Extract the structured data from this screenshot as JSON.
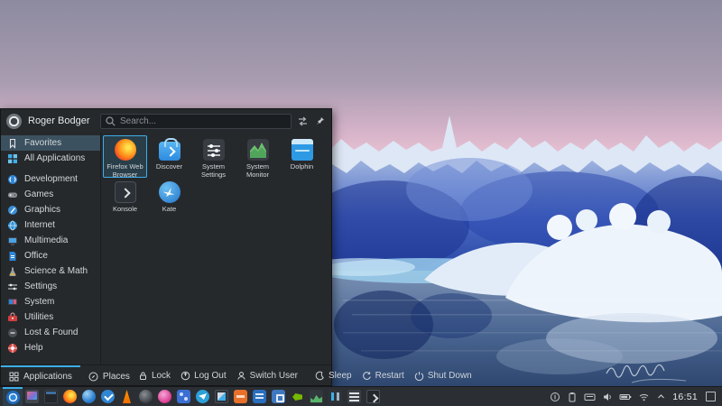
{
  "colors": {
    "accent": "#3daee9",
    "panel_bg": "#2b2f34",
    "menu_bg": "#26292c",
    "selection_bg": "#3c5160"
  },
  "launcher": {
    "user": {
      "name": "Roger Bodger",
      "avatar_icon": "kubuntu-user-logo"
    },
    "search": {
      "placeholder": "Search...",
      "leading_icon": "search-icon",
      "trailing_icons": [
        "sort-icon",
        "pin-icon"
      ]
    },
    "sidebar": {
      "selected": "Favorites",
      "items": [
        {
          "label": "Favorites",
          "icon": "bookmark-icon"
        },
        {
          "label": "All Applications",
          "icon": "apps-grid-icon"
        },
        {
          "label": "Development",
          "icon": "development-icon"
        },
        {
          "label": "Games",
          "icon": "games-icon"
        },
        {
          "label": "Graphics",
          "icon": "graphics-icon"
        },
        {
          "label": "Internet",
          "icon": "internet-globe-icon"
        },
        {
          "label": "Multimedia",
          "icon": "multimedia-icon"
        },
        {
          "label": "Office",
          "icon": "office-icon"
        },
        {
          "label": "Science & Math",
          "icon": "science-math-icon"
        },
        {
          "label": "Settings",
          "icon": "settings-sliders-icon"
        },
        {
          "label": "System",
          "icon": "system-monitor-icon"
        },
        {
          "label": "Utilities",
          "icon": "utilities-toolbox-icon"
        },
        {
          "label": "Lost & Found",
          "icon": "lost-found-icon"
        },
        {
          "label": "Help",
          "icon": "help-lifebuoy-icon"
        }
      ]
    },
    "apps": [
      {
        "label": "Firefox Web Browser",
        "icon": "firefox-icon",
        "selected": true
      },
      {
        "label": "Discover",
        "icon": "discover-icon",
        "selected": false
      },
      {
        "label": "System Settings",
        "icon": "system-settings-icon",
        "selected": false
      },
      {
        "label": "System Monitor",
        "icon": "system-monitor-icon",
        "selected": false
      },
      {
        "label": "Dolphin",
        "icon": "dolphin-icon",
        "selected": false
      },
      {
        "label": "Konsole",
        "icon": "konsole-icon",
        "selected": false
      },
      {
        "label": "Kate",
        "icon": "kate-icon",
        "selected": false
      }
    ],
    "footer": {
      "tabs": [
        {
          "label": "Applications",
          "icon": "grid-tab-icon",
          "active": true
        },
        {
          "label": "Places",
          "icon": "compass-icon",
          "active": false
        }
      ],
      "actions": [
        {
          "label": "Lock",
          "icon": "lock-icon"
        },
        {
          "label": "Log Out",
          "icon": "logout-icon"
        },
        {
          "label": "Switch User",
          "icon": "switch-user-icon"
        },
        {
          "label": "Sleep",
          "icon": "sleep-icon"
        },
        {
          "label": "Restart",
          "icon": "restart-icon"
        },
        {
          "label": "Shut Down",
          "icon": "shutdown-icon"
        }
      ]
    }
  },
  "taskbar": {
    "launcher_icon": "kubuntu-logo-icon",
    "pinned_icons": [
      "display-settings-icon",
      "window-icon",
      "firefox-icon",
      "blue-sphere-app-icon",
      "check-app-icon",
      "vlc-icon",
      "gimp-icon",
      "pink-media-app-icon",
      "virtualbox-icon",
      "telegram-icon",
      "video-editor-icon",
      "libreoffice-impress-icon",
      "libreoffice-writer-icon",
      "toolbox-app-icon",
      "nvidia-settings-icon",
      "system-monitor-icon",
      "partition-manager-icon",
      "system-settings-icon",
      "konsole-icon"
    ],
    "tray": {
      "icons": [
        "status-icon",
        "clipboard-icon",
        "input-device-icon",
        "volume-icon",
        "battery-icon",
        "network-wifi-icon",
        "expand-caret-icon"
      ],
      "time": "16:51",
      "show_desktop": "show-desktop-button"
    }
  }
}
